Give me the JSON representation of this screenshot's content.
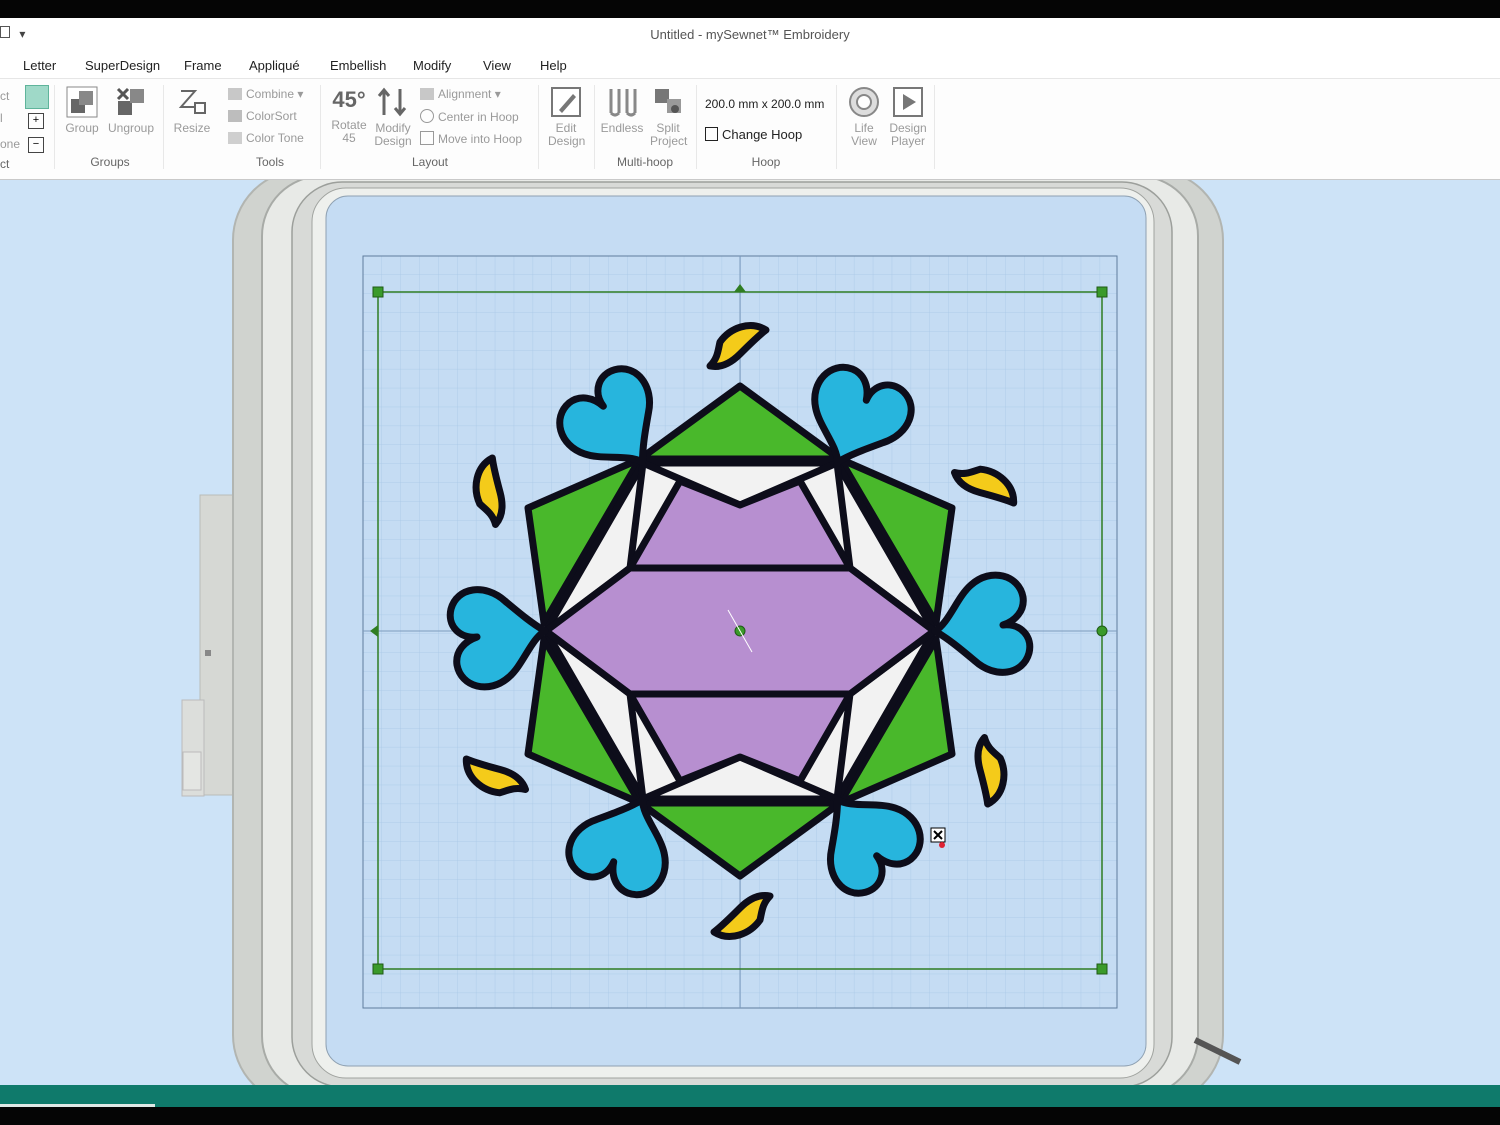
{
  "window": {
    "title": "Untitled - mySewnet™ Embroidery",
    "quick_access": "▾"
  },
  "tabs": [
    "Letter",
    "SuperDesign",
    "Frame",
    "Appliqué",
    "Embellish",
    "Modify",
    "View",
    "Help"
  ],
  "ribbon": {
    "left_cut_labels": [
      "ct",
      "l",
      "one",
      "ct"
    ],
    "groups": {
      "groups": {
        "label": "Groups",
        "group": "Group",
        "ungroup": "Ungroup"
      },
      "tools": {
        "label": "Tools",
        "resize": "Resize",
        "combine": "Combine",
        "colorsort": "ColorSort",
        "colortone": "Color Tone"
      },
      "layout": {
        "label": "Layout",
        "rotate": "Rotate 45",
        "rotate_icon_text": "45°",
        "modify": "Modify Design",
        "alignment": "Alignment",
        "center": "Center in Hoop",
        "move": "Move into Hoop"
      },
      "edit": {
        "edit": "Edit Design"
      },
      "multihoop": {
        "label": "Multi-hoop",
        "endless": "Endless",
        "split": "Split Project"
      },
      "hoop": {
        "label": "Hoop",
        "size": "200.0 mm x 200.0 mm",
        "change": "Change Hoop"
      },
      "view": {
        "life": "Life View",
        "player": "Design Player"
      }
    }
  },
  "colors": {
    "heart": "#27b5dd",
    "leaf": "#f4cb1a",
    "star": "#b78fd0",
    "green": "#49b82b",
    "white_fill": "#f2f2f2",
    "outline": "#0d0d1a",
    "selection": "#2f7d22",
    "hoop_field": "#c5dcf3",
    "workspace": "#cde3f7",
    "status": "#0f7a6b"
  }
}
